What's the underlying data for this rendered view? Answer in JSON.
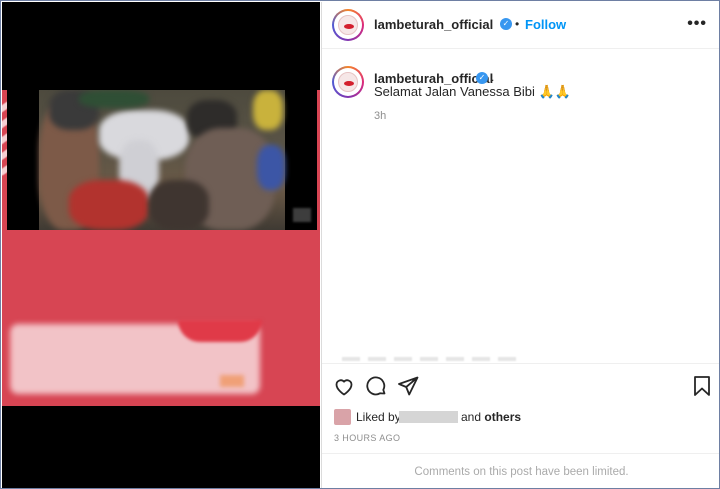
{
  "post": {
    "username": "lambeturah_official",
    "follow_label": "Follow",
    "dot": "•",
    "more_icon": "more-horizontal-icon",
    "caption_dot": ".",
    "caption_text": "Selamat Jalan Vanessa Bibi 🙏🙏",
    "relative_time": "3h",
    "liked_by_label": "Liked by",
    "and_label": "and",
    "others_label": "others",
    "absolute_time": "3 HOURS AGO",
    "comments_limited": "Comments on this post have been limited."
  },
  "colors": {
    "accent": "#0095f6",
    "verified": "#3897f0",
    "brand_red": "#d74553",
    "text": "#262626",
    "muted": "#8e8e8e"
  },
  "icons": [
    "heart-icon",
    "comment-icon",
    "share-icon",
    "bookmark-icon",
    "verified-badge-icon"
  ]
}
